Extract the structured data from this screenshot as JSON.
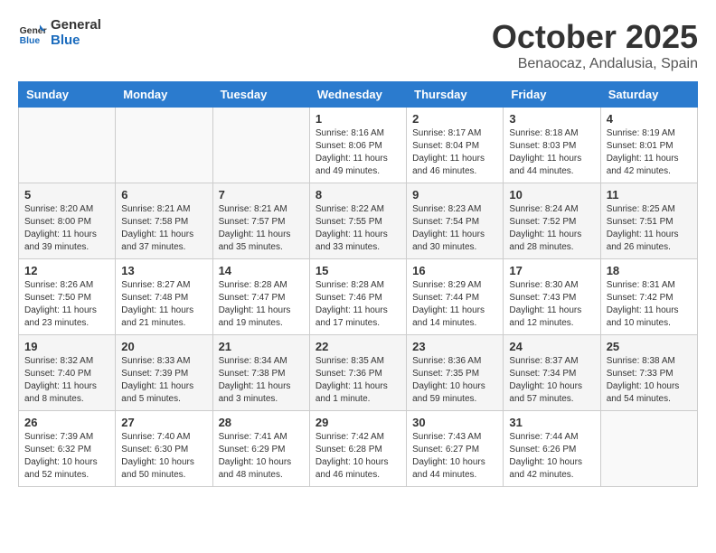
{
  "logo": {
    "line1": "General",
    "line2": "Blue"
  },
  "title": "October 2025",
  "subtitle": "Benaocaz, Andalusia, Spain",
  "days_of_week": [
    "Sunday",
    "Monday",
    "Tuesday",
    "Wednesday",
    "Thursday",
    "Friday",
    "Saturday"
  ],
  "weeks": [
    [
      {
        "day": "",
        "info": ""
      },
      {
        "day": "",
        "info": ""
      },
      {
        "day": "",
        "info": ""
      },
      {
        "day": "1",
        "info": "Sunrise: 8:16 AM\nSunset: 8:06 PM\nDaylight: 11 hours and 49 minutes."
      },
      {
        "day": "2",
        "info": "Sunrise: 8:17 AM\nSunset: 8:04 PM\nDaylight: 11 hours and 46 minutes."
      },
      {
        "day": "3",
        "info": "Sunrise: 8:18 AM\nSunset: 8:03 PM\nDaylight: 11 hours and 44 minutes."
      },
      {
        "day": "4",
        "info": "Sunrise: 8:19 AM\nSunset: 8:01 PM\nDaylight: 11 hours and 42 minutes."
      }
    ],
    [
      {
        "day": "5",
        "info": "Sunrise: 8:20 AM\nSunset: 8:00 PM\nDaylight: 11 hours and 39 minutes."
      },
      {
        "day": "6",
        "info": "Sunrise: 8:21 AM\nSunset: 7:58 PM\nDaylight: 11 hours and 37 minutes."
      },
      {
        "day": "7",
        "info": "Sunrise: 8:21 AM\nSunset: 7:57 PM\nDaylight: 11 hours and 35 minutes."
      },
      {
        "day": "8",
        "info": "Sunrise: 8:22 AM\nSunset: 7:55 PM\nDaylight: 11 hours and 33 minutes."
      },
      {
        "day": "9",
        "info": "Sunrise: 8:23 AM\nSunset: 7:54 PM\nDaylight: 11 hours and 30 minutes."
      },
      {
        "day": "10",
        "info": "Sunrise: 8:24 AM\nSunset: 7:52 PM\nDaylight: 11 hours and 28 minutes."
      },
      {
        "day": "11",
        "info": "Sunrise: 8:25 AM\nSunset: 7:51 PM\nDaylight: 11 hours and 26 minutes."
      }
    ],
    [
      {
        "day": "12",
        "info": "Sunrise: 8:26 AM\nSunset: 7:50 PM\nDaylight: 11 hours and 23 minutes."
      },
      {
        "day": "13",
        "info": "Sunrise: 8:27 AM\nSunset: 7:48 PM\nDaylight: 11 hours and 21 minutes."
      },
      {
        "day": "14",
        "info": "Sunrise: 8:28 AM\nSunset: 7:47 PM\nDaylight: 11 hours and 19 minutes."
      },
      {
        "day": "15",
        "info": "Sunrise: 8:28 AM\nSunset: 7:46 PM\nDaylight: 11 hours and 17 minutes."
      },
      {
        "day": "16",
        "info": "Sunrise: 8:29 AM\nSunset: 7:44 PM\nDaylight: 11 hours and 14 minutes."
      },
      {
        "day": "17",
        "info": "Sunrise: 8:30 AM\nSunset: 7:43 PM\nDaylight: 11 hours and 12 minutes."
      },
      {
        "day": "18",
        "info": "Sunrise: 8:31 AM\nSunset: 7:42 PM\nDaylight: 11 hours and 10 minutes."
      }
    ],
    [
      {
        "day": "19",
        "info": "Sunrise: 8:32 AM\nSunset: 7:40 PM\nDaylight: 11 hours and 8 minutes."
      },
      {
        "day": "20",
        "info": "Sunrise: 8:33 AM\nSunset: 7:39 PM\nDaylight: 11 hours and 5 minutes."
      },
      {
        "day": "21",
        "info": "Sunrise: 8:34 AM\nSunset: 7:38 PM\nDaylight: 11 hours and 3 minutes."
      },
      {
        "day": "22",
        "info": "Sunrise: 8:35 AM\nSunset: 7:36 PM\nDaylight: 11 hours and 1 minute."
      },
      {
        "day": "23",
        "info": "Sunrise: 8:36 AM\nSunset: 7:35 PM\nDaylight: 10 hours and 59 minutes."
      },
      {
        "day": "24",
        "info": "Sunrise: 8:37 AM\nSunset: 7:34 PM\nDaylight: 10 hours and 57 minutes."
      },
      {
        "day": "25",
        "info": "Sunrise: 8:38 AM\nSunset: 7:33 PM\nDaylight: 10 hours and 54 minutes."
      }
    ],
    [
      {
        "day": "26",
        "info": "Sunrise: 7:39 AM\nSunset: 6:32 PM\nDaylight: 10 hours and 52 minutes."
      },
      {
        "day": "27",
        "info": "Sunrise: 7:40 AM\nSunset: 6:30 PM\nDaylight: 10 hours and 50 minutes."
      },
      {
        "day": "28",
        "info": "Sunrise: 7:41 AM\nSunset: 6:29 PM\nDaylight: 10 hours and 48 minutes."
      },
      {
        "day": "29",
        "info": "Sunrise: 7:42 AM\nSunset: 6:28 PM\nDaylight: 10 hours and 46 minutes."
      },
      {
        "day": "30",
        "info": "Sunrise: 7:43 AM\nSunset: 6:27 PM\nDaylight: 10 hours and 44 minutes."
      },
      {
        "day": "31",
        "info": "Sunrise: 7:44 AM\nSunset: 6:26 PM\nDaylight: 10 hours and 42 minutes."
      },
      {
        "day": "",
        "info": ""
      }
    ]
  ]
}
